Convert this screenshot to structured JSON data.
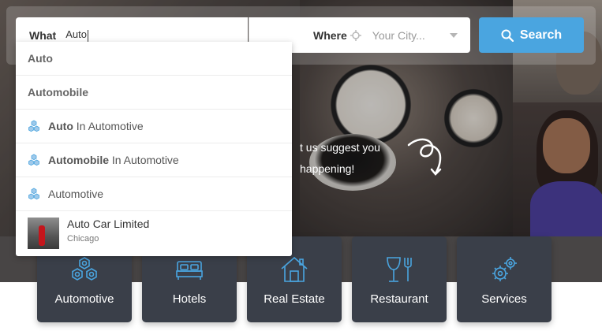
{
  "search": {
    "what_label": "What",
    "what_value": "Auto",
    "where_label": "Where",
    "where_placeholder": "Your City...",
    "button_label": "Search"
  },
  "hero": {
    "line1": "t us suggest you",
    "line2": "happening!"
  },
  "suggestions": [
    {
      "type": "keyword",
      "text": "Auto"
    },
    {
      "type": "keyword",
      "text": "Automobile"
    },
    {
      "type": "category",
      "bold": "Auto",
      "rest": " In Automotive"
    },
    {
      "type": "category",
      "bold": "Automobile",
      "rest": " In Automotive"
    },
    {
      "type": "category",
      "bold": "",
      "rest": "Automotive"
    }
  ],
  "place": {
    "title": "Auto Car Limited",
    "city": "Chicago"
  },
  "categories": [
    {
      "label": "Automotive",
      "icon": "gears-icon"
    },
    {
      "label": "Hotels",
      "icon": "bed-icon"
    },
    {
      "label": "Real Estate",
      "icon": "house-icon"
    },
    {
      "label": "Restaurant",
      "icon": "dining-icon"
    },
    {
      "label": "Services",
      "icon": "cogs-icon"
    }
  ],
  "colors": {
    "accent": "#4aa5e0",
    "card_bg": "#3a3f49"
  }
}
